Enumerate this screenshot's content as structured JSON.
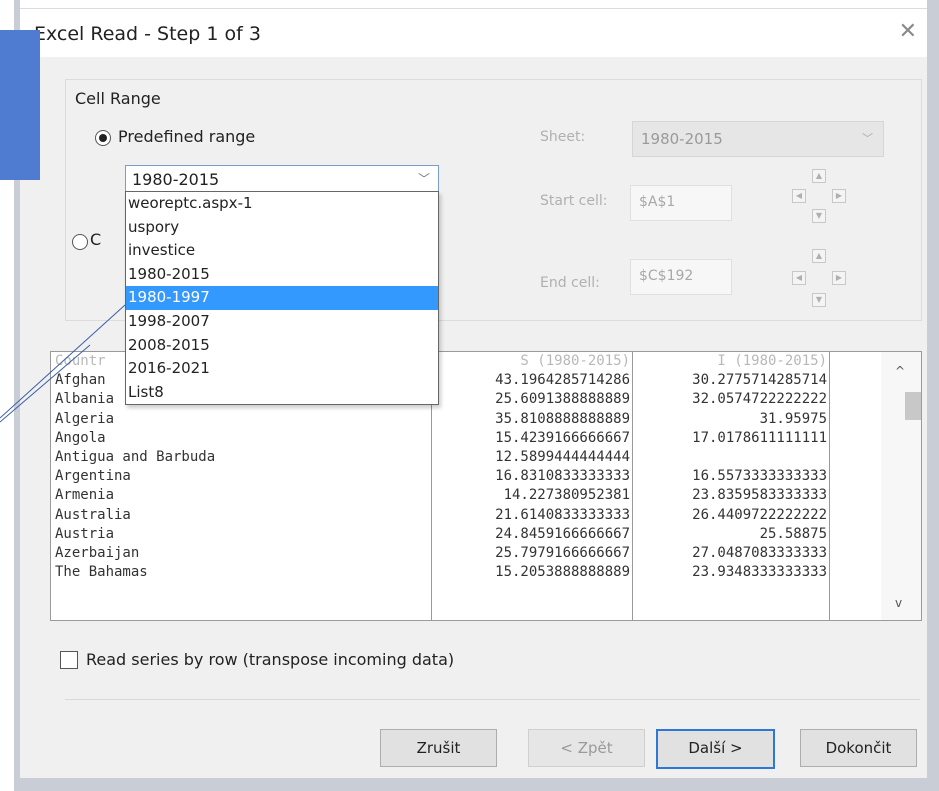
{
  "window": {
    "title": "Excel Read - Step 1 of 3",
    "close_glyph": "✕"
  },
  "cell_range": {
    "label": "Cell Range",
    "predefined_label": "Predefined range",
    "custom_label": "C",
    "combo_value": "1980-2015",
    "dropdown_items": [
      "weoreptc.aspx-1",
      "uspory",
      "investice",
      "1980-2015",
      "1980-1997",
      "1998-2007",
      "2008-2015",
      "2016-2021",
      "List8"
    ],
    "selected_index": 4
  },
  "sheet": {
    "label": "Sheet:",
    "value": "1980-2015"
  },
  "start_cell": {
    "label": "Start cell:",
    "value": "$A$1"
  },
  "end_cell": {
    "label": "End cell:",
    "value": "$C$192"
  },
  "preview": {
    "col1": [
      "Countr",
      "Afghan",
      "Albania",
      "Algeria",
      "Angola",
      "Antigua and Barbuda",
      "Argentina",
      "Armenia",
      "Australia",
      "Austria",
      "Azerbaijan",
      "The Bahamas"
    ],
    "col2": [
      "S (1980-2015)",
      "43.1964285714286",
      "25.6091388888889",
      "35.8108888888889",
      "15.4239166666667",
      "12.5899444444444",
      "16.8310833333333",
      "14.227380952381",
      "21.6140833333333",
      "24.8459166666667",
      "25.7979166666667",
      "15.2053888888889"
    ],
    "col3": [
      "I (1980-2015)",
      "30.2775714285714",
      "32.0574722222222",
      "31.95975",
      "17.0178611111111",
      "",
      "16.5573333333333",
      "23.8359583333333",
      "26.4409722222222",
      "25.58875",
      "27.0487083333333",
      "23.9348333333333"
    ]
  },
  "transpose": {
    "label": "Read series by row (transpose incoming data)",
    "checked": false
  },
  "buttons": {
    "cancel": "Zrušit",
    "back": "< Zpět",
    "next": "Další >",
    "finish": "Dokončit"
  },
  "colors": {
    "accent": "#3399ff",
    "callout": "#4f7bd0",
    "default_border": "#2d77d6"
  }
}
